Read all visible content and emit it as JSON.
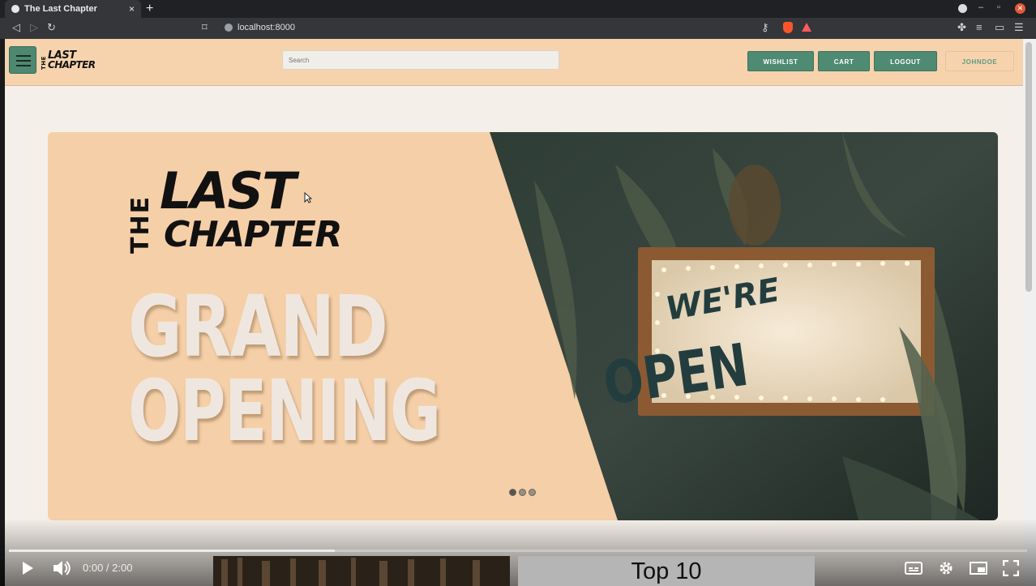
{
  "browser": {
    "tab_title": "The Last Chapter",
    "tab_close": "×",
    "new_tab": "+",
    "url": "localhost:8000"
  },
  "site": {
    "logo_the": "THE",
    "logo_line1": "LAST",
    "logo_line2": "CHAPTER",
    "search_placeholder": "Search",
    "nav": {
      "wishlist": "WISHLIST",
      "cart": "CART",
      "logout": "LOGOUT",
      "user": "JOHNDOE"
    },
    "accent_color": "#4f8a73",
    "header_color": "#f6d3ad"
  },
  "hero": {
    "brand_the": "THE",
    "brand_last": "LAST",
    "brand_chapter": "CHAPTER",
    "headline_line1": "GRAND",
    "headline_line2": "OPENING",
    "sign_line1": "WE'RE",
    "sign_line2": "OPEN",
    "slide_count": 3,
    "active_slide": 1
  },
  "player": {
    "time": "0:00 / 2:00",
    "progress_fraction": 0.32,
    "next_title": "Top 10"
  }
}
